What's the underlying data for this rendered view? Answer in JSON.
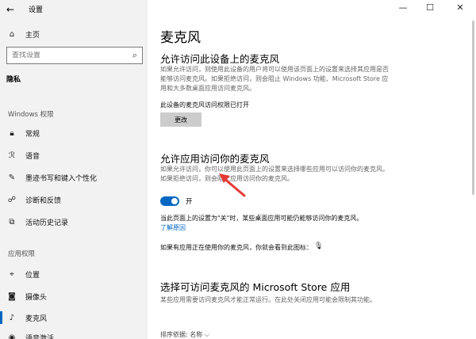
{
  "window": {
    "app_title": "设置",
    "controls": {
      "minimize": "—",
      "maximize": "☐",
      "close": "✕"
    }
  },
  "sidebar": {
    "home_label": "主页",
    "search_placeholder": "查找设置",
    "category": "隐私",
    "windows_perm_label": "Windows 权限",
    "windows_items": [
      {
        "label": "常规",
        "icon": "lock-icon"
      },
      {
        "label": "语音",
        "icon": "speech-icon"
      },
      {
        "label": "墨迹书写和键入个性化",
        "icon": "pen-icon"
      },
      {
        "label": "诊断和反馈",
        "icon": "diagnostics-icon"
      },
      {
        "label": "活动历史记录",
        "icon": "history-icon"
      }
    ],
    "app_perm_label": "应用权限",
    "app_items": [
      {
        "label": "位置",
        "icon": "location-icon"
      },
      {
        "label": "摄像头",
        "icon": "camera-icon"
      },
      {
        "label": "麦克风",
        "icon": "microphone-icon"
      },
      {
        "label": "语音激活",
        "icon": "voice-activation-icon"
      }
    ],
    "active_item": "麦克风"
  },
  "main": {
    "title": "麦克风",
    "section1": {
      "heading": "允许访问此设备上的麦克风",
      "desc": "如果允许访问，则使用此设备的用户将可以使用该页面上的设置来选择其应用是否能够访问麦克风。如果拒绝访问，则会阻止 Windows 功能、Microsoft Store 应用和大多数桌面应用访问麦克风。",
      "status": "此设备的麦克风访问权限已打开",
      "button": "更改"
    },
    "section2": {
      "heading": "允许应用访问你的麦克风",
      "desc": "如果允许访问，你可以使用此页面上的设置来选择哪些应用可以访问你的麦克风。如果拒绝访问，则会阻止应用访问你的麦克风。",
      "toggle_label": "开",
      "toggle_on": true,
      "note": "当此页面上的设置为\"关\"时，某些桌面应用可能仍能够访问你的麦克风。",
      "link": "了解原因",
      "in_use": "如果有应用正在使用你的麦克风，你就会看到此图标："
    },
    "section3": {
      "heading": "选择可访问麦克风的 Microsoft Store 应用",
      "desc": "某些应用需要访问麦克风才能正常运行。在此处关闭应用可能会限制其功能。",
      "sort_label": "排序依据: 名称"
    }
  },
  "colors": {
    "accent": "#0067c0",
    "sidebar_bg": "#f2f2f2",
    "annotation_arrow": "#e53935"
  }
}
